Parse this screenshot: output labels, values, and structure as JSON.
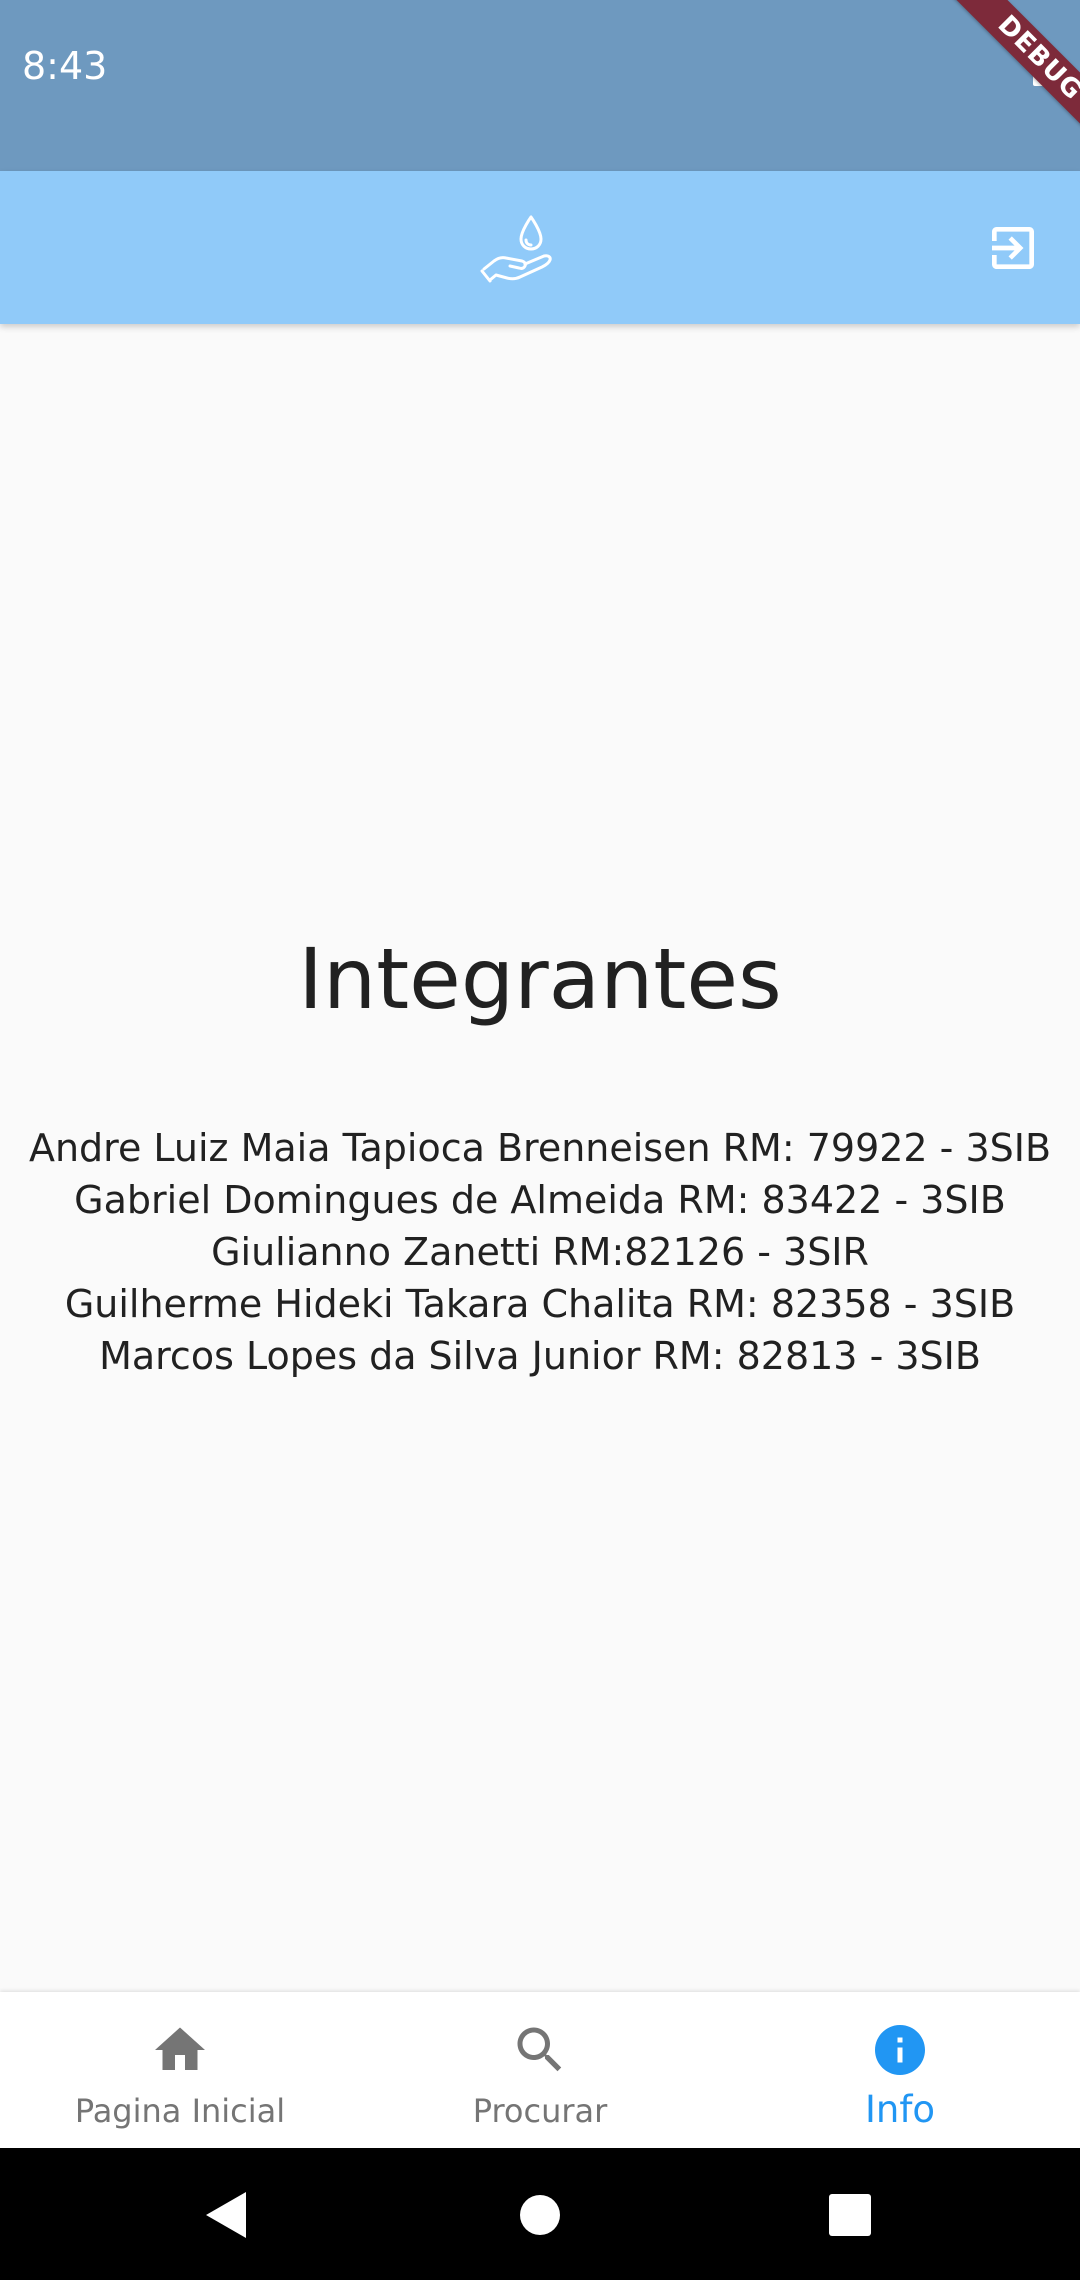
{
  "status_bar": {
    "time": "8:43",
    "battery_icon": "battery-full-icon"
  },
  "debug_banner": {
    "label": "DEBUG"
  },
  "app_bar": {
    "logo_icon": "hand-water-drop-icon",
    "logout_icon": "exit-to-app-icon"
  },
  "content": {
    "title": "Integrantes",
    "members": [
      "Andre Luiz Maia Tapioca Brenneisen RM: 79922 - 3SIB",
      "Gabriel Domingues de Almeida RM: 83422 - 3SIB",
      "Giulianno Zanetti RM:82126 - 3SIR",
      "Guilherme Hideki Takara Chalita RM: 82358 - 3SIB",
      "Marcos Lopes da Silva Junior RM: 82813 - 3SIB"
    ]
  },
  "bottom_nav": {
    "items": [
      {
        "label": "Pagina Inicial",
        "icon": "home-icon",
        "active": false
      },
      {
        "label": "Procurar",
        "icon": "search-icon",
        "active": false
      },
      {
        "label": "Info",
        "icon": "info-icon",
        "active": true
      }
    ],
    "active_color": "#2196f3",
    "inactive_color": "#757575"
  },
  "colors": {
    "status_bar": "#6e99bf",
    "app_bar": "#90caf9",
    "background": "#fafafa",
    "debug_banner": "#7d2a3a"
  },
  "system_nav": {
    "buttons": [
      "back-icon",
      "home-circle-icon",
      "recents-icon"
    ]
  }
}
